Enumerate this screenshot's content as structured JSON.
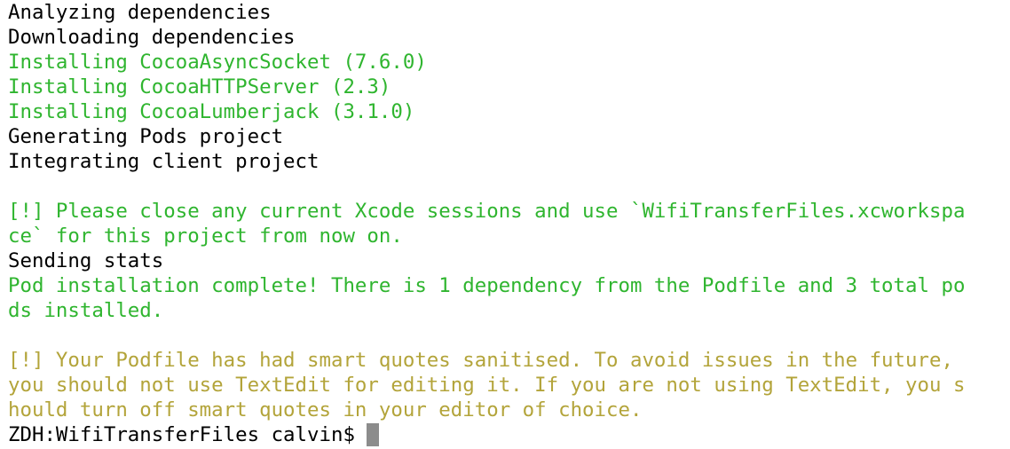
{
  "terminal": {
    "lines": [
      {
        "text": "Analyzing dependencies",
        "color": "#000000"
      },
      {
        "text": "Downloading dependencies",
        "color": "#000000"
      },
      {
        "text": "Installing CocoaAsyncSocket (7.6.0)",
        "color": "#2fb52f"
      },
      {
        "text": "Installing CocoaHTTPServer (2.3)",
        "color": "#2fb52f"
      },
      {
        "text": "Installing CocoaLumberjack (3.1.0)",
        "color": "#2fb52f"
      },
      {
        "text": "Generating Pods project",
        "color": "#000000"
      },
      {
        "text": "Integrating client project",
        "color": "#000000"
      },
      {
        "text": "",
        "color": "#000000"
      },
      {
        "text": "[!] Please close any current Xcode sessions and use `WifiTransferFiles.xcworkspa",
        "color": "#2fb52f"
      },
      {
        "text": "ce` for this project from now on.",
        "color": "#2fb52f"
      },
      {
        "text": "Sending stats",
        "color": "#000000"
      },
      {
        "text": "Pod installation complete! There is 1 dependency from the Podfile and 3 total po",
        "color": "#2fb52f"
      },
      {
        "text": "ds installed.",
        "color": "#2fb52f"
      },
      {
        "text": "",
        "color": "#000000"
      },
      {
        "text": "[!] Your Podfile has had smart quotes sanitised. To avoid issues in the future,",
        "color": "#b3a43a"
      },
      {
        "text": "you should not use TextEdit for editing it. If you are not using TextEdit, you s",
        "color": "#b3a43a"
      },
      {
        "text": "hould turn off smart quotes in your editor of choice.",
        "color": "#b3a43a"
      }
    ],
    "prompt": "ZDH:WifiTransferFiles calvin$ "
  }
}
